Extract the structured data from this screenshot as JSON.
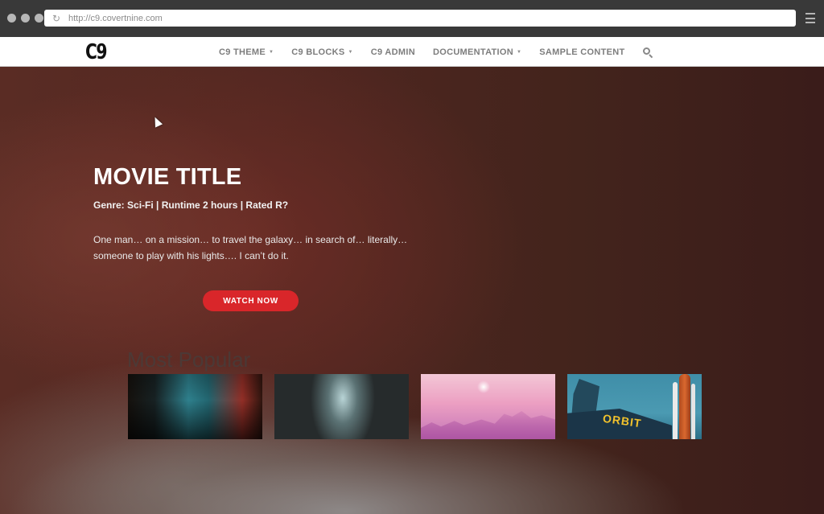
{
  "browser": {
    "url": "http://c9.covertnine.com",
    "window_buttons": [
      "close",
      "minimize",
      "maximize"
    ],
    "icons": {
      "reload": "reload-icon",
      "menu": "hamburger-menu-icon"
    }
  },
  "navbar": {
    "logo": "C9",
    "items": [
      {
        "label": "C9 THEME",
        "dropdown": true
      },
      {
        "label": "C9 BLOCKS",
        "dropdown": true
      },
      {
        "label": "C9 ADMIN",
        "dropdown": false
      },
      {
        "label": "DOCUMENTATION",
        "dropdown": true
      },
      {
        "label": "SAMPLE CONTENT",
        "dropdown": false
      }
    ],
    "caret": "▼",
    "search_icon": "search-icon"
  },
  "hero": {
    "title": "MOVIE TITLE",
    "meta": "Genre: Sci-Fi | Runtime 2 hours | Rated R?",
    "description": "One man… on a mission… to travel the galaxy… in search of… literally… someone to play with his lights…. I can’t do it.",
    "cta_label": "WATCH NOW",
    "cta_color": "#d9262a"
  },
  "popular": {
    "title": "Most Popular",
    "thumbnails": [
      {
        "subject": "people at a neon storefront at night"
      },
      {
        "subject": "figure under a beam of light in darkness"
      },
      {
        "subject": "pink hazy city skyline with sun"
      },
      {
        "subject": "Orbit Cafe sign with space shuttle"
      }
    ],
    "orbit_sign": "ORBIT"
  }
}
